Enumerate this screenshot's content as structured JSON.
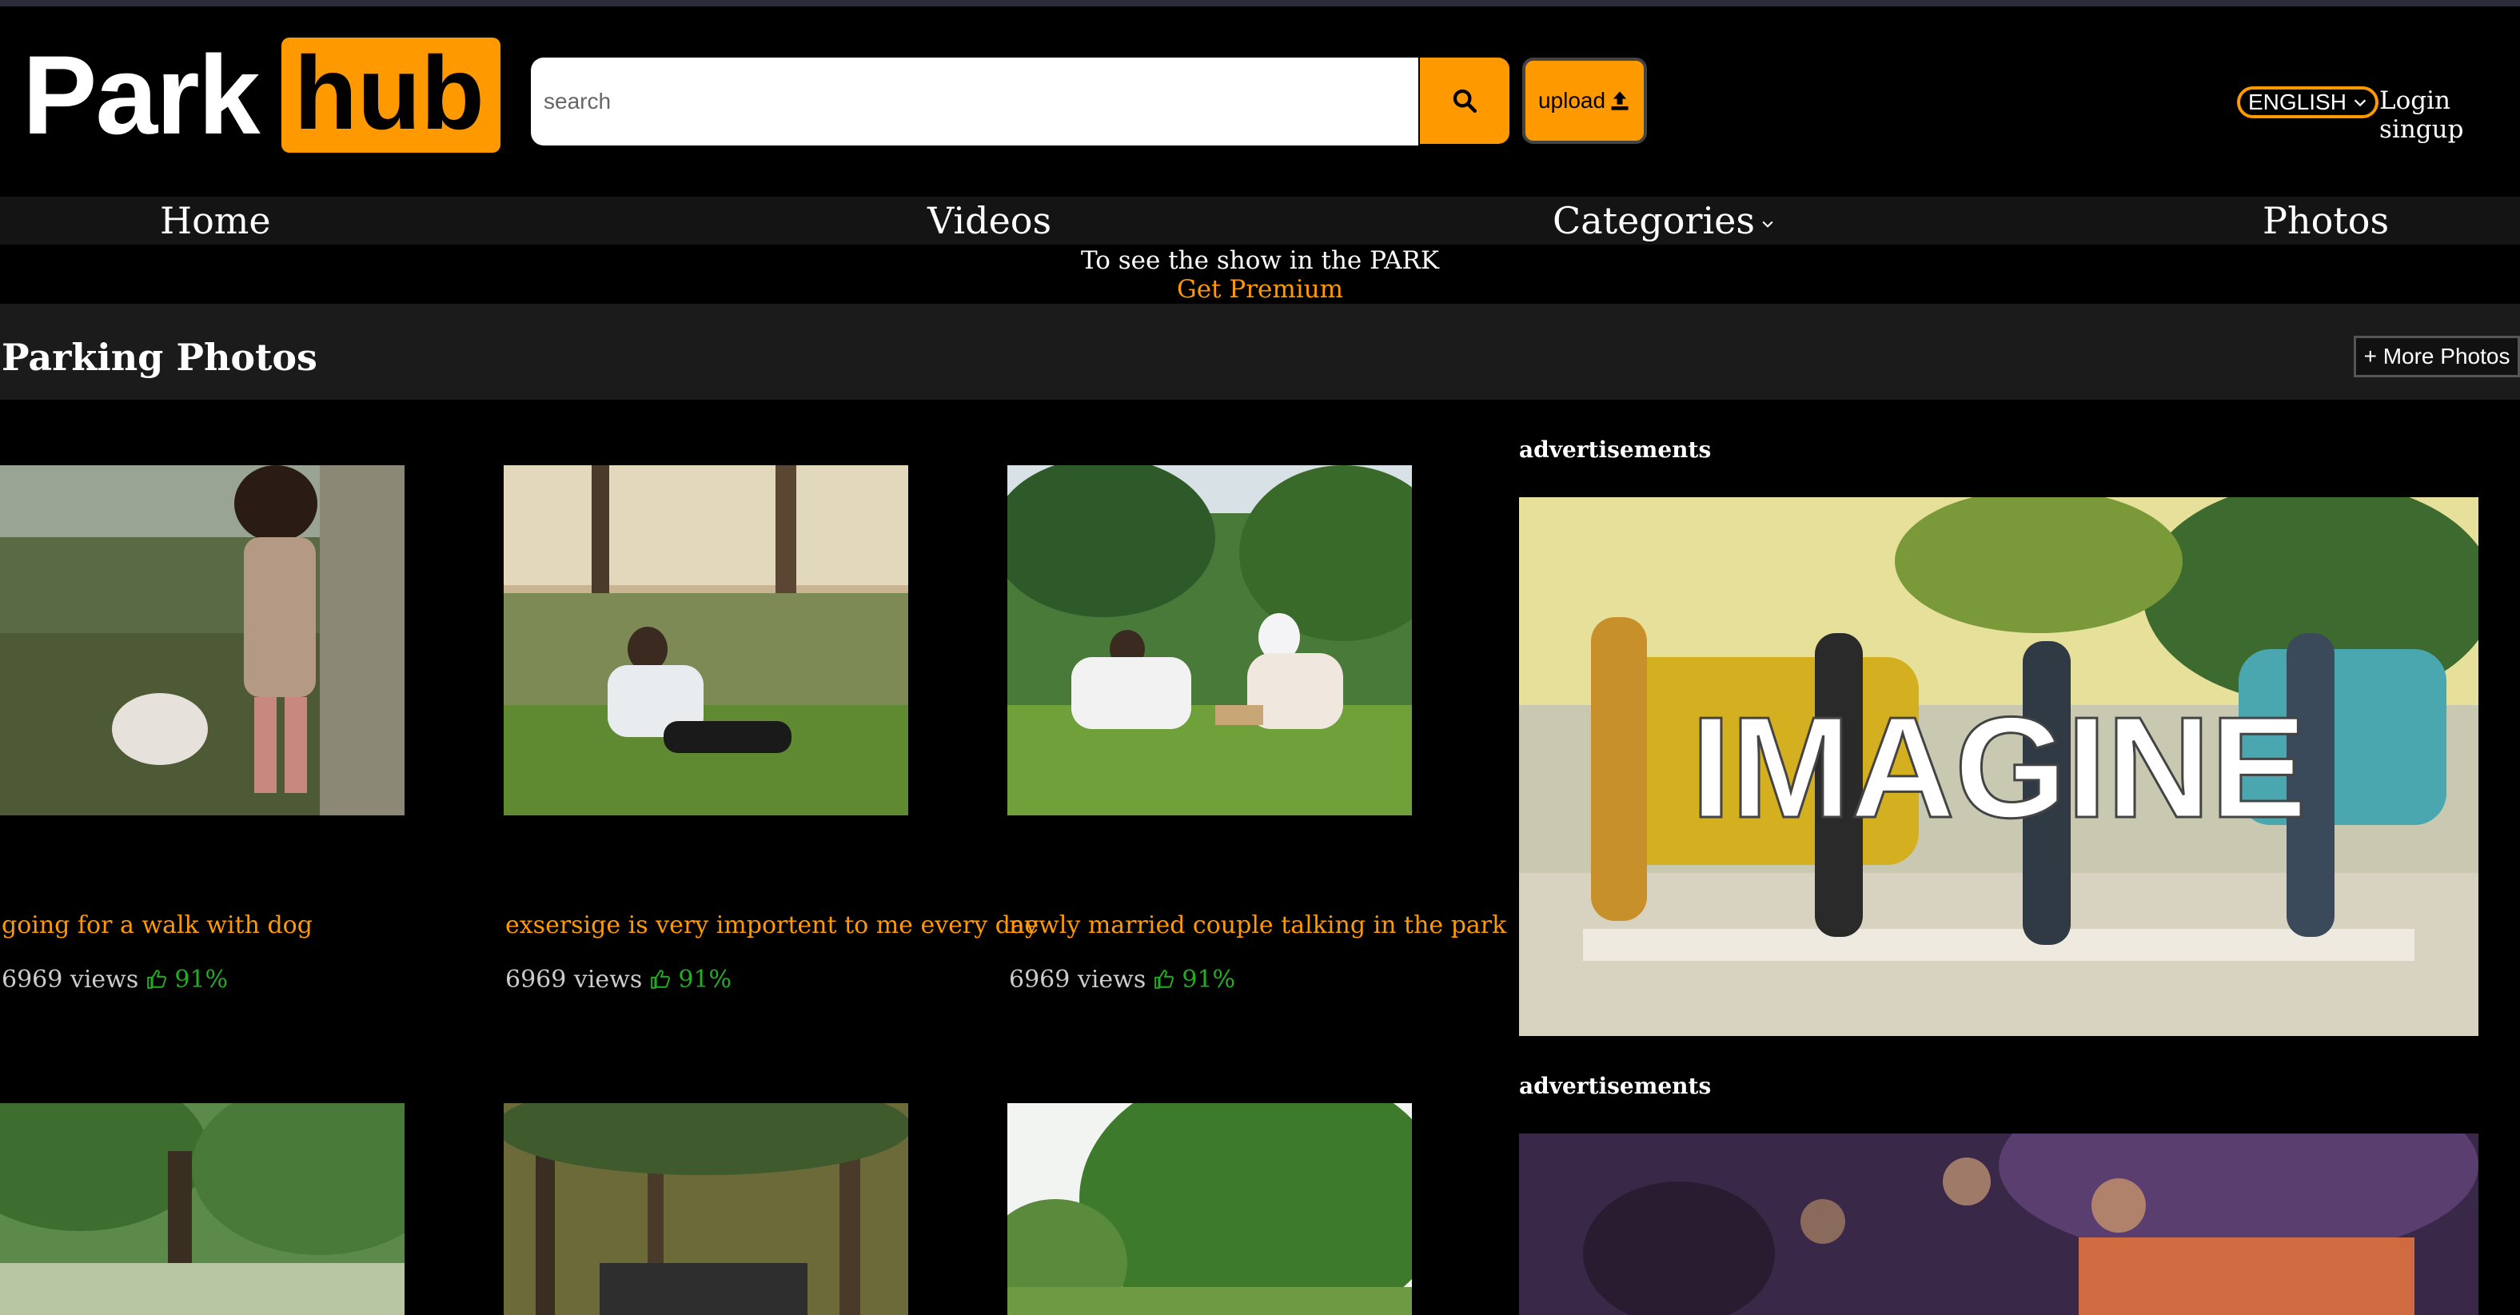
{
  "header": {
    "logo_part1": "Park",
    "logo_part2": "hub",
    "search_placeholder": "search",
    "upload_label": "upload",
    "language": "ENGLISH",
    "login_label": "Login singup"
  },
  "nav": {
    "items": [
      "Home",
      "Videos",
      "Categories",
      "Photos"
    ]
  },
  "promo": {
    "line1": "To see the show in the PARK",
    "line2": "Get Premium"
  },
  "section": {
    "title": "Parking Photos",
    "more_label": "+ More Photos"
  },
  "cards": [
    {
      "title": "going for a walk with dog",
      "views": "6969 views",
      "rating": "91%"
    },
    {
      "title": "exsersige is very importent to me every day",
      "views": "6969 views",
      "rating": "91%"
    },
    {
      "title": "newly married couple talking in the park",
      "views": "6969 views",
      "rating": "91%"
    }
  ],
  "ads": {
    "label": "advertisements",
    "banner1_text": "IMAGINE"
  },
  "colors": {
    "accent": "#ff9900",
    "background": "#000000",
    "nav_background": "#141414",
    "section_background": "#1b1b1b",
    "rating": "#21b021"
  }
}
